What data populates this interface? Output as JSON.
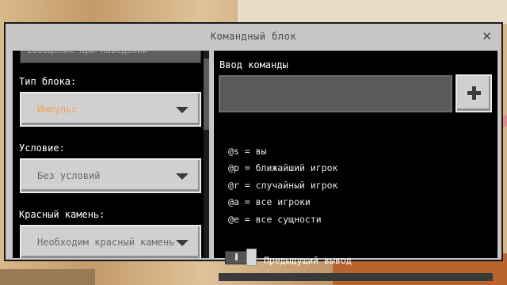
{
  "dialog": {
    "title": "Командный блок",
    "close_glyph": "✕"
  },
  "left": {
    "partial_field_text": "Сообщение при наведении",
    "block_type": {
      "label": "Тип блока:",
      "value": "Импульс"
    },
    "condition": {
      "label": "Условие:",
      "value": "Без условий"
    },
    "redstone": {
      "label": "Красный камень:",
      "value": "Необходим красный камень"
    }
  },
  "right": {
    "command_label": "Ввод команды",
    "command_value": "",
    "add_button_icon": "plus-icon",
    "selectors": [
      "@s = вы",
      "@p = ближайший игрок",
      "@r = случайный игрок",
      "@a = все игроки",
      "@e = все сущности"
    ],
    "previous_output_label": "Предыдущий вывод"
  },
  "colors": {
    "dialog_bg": "#c6c6c6",
    "panel_bg": "#000000",
    "dropdown_bg": "#d0d0d0",
    "impulse_orange": "#f3a35a"
  }
}
